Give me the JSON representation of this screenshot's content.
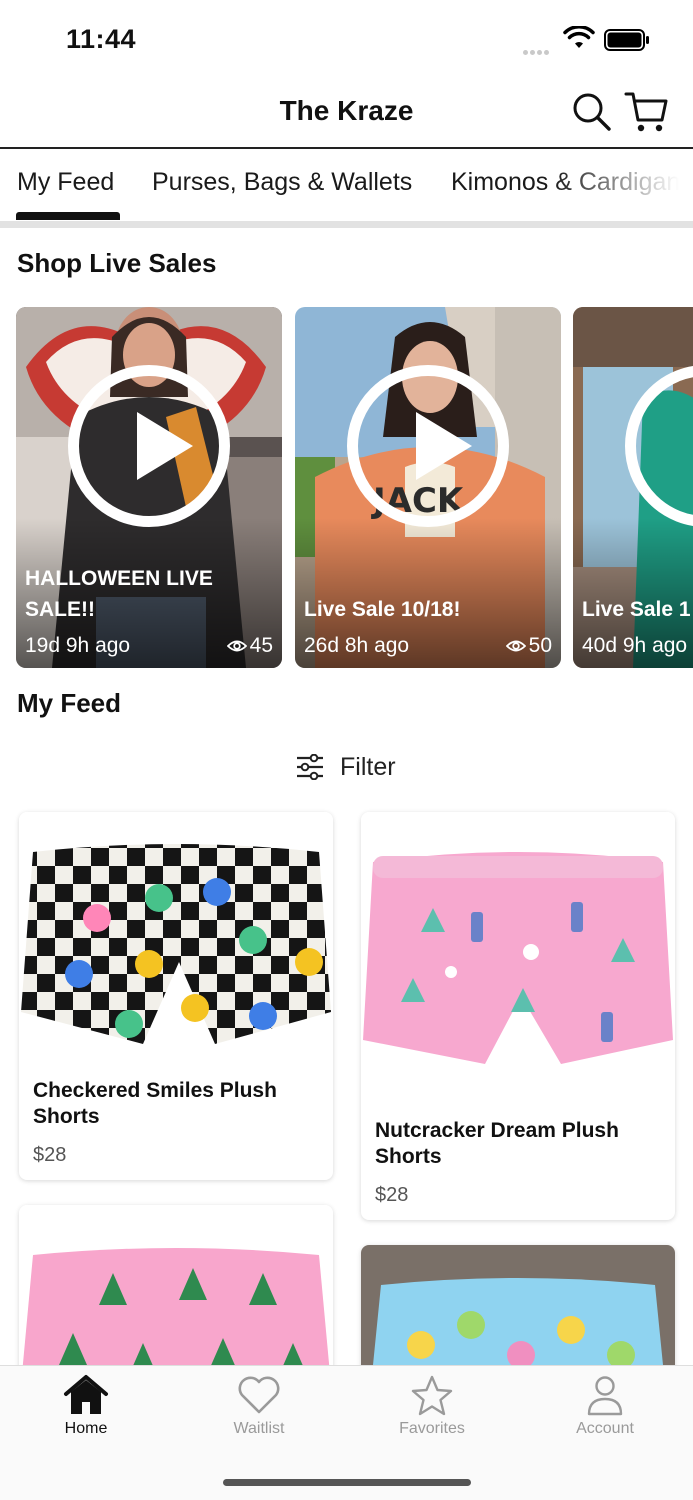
{
  "status_bar": {
    "time": "11:44"
  },
  "header": {
    "title": "The Kraze"
  },
  "tabs": [
    {
      "label": "My Feed",
      "active": true
    },
    {
      "label": "Purses, Bags & Wallets",
      "active": false
    },
    {
      "label": "Kimonos & Cardigans",
      "active": false
    }
  ],
  "live_section": {
    "title": "Shop Live Sales",
    "cards": [
      {
        "title": "HALLOWEEN LIVE SALE!!",
        "ago": "19d 9h ago",
        "views": "45"
      },
      {
        "title": "Live Sale 10/18!",
        "ago": "26d 8h ago",
        "views": "50"
      },
      {
        "title": "Live Sale 1",
        "ago": "40d 9h ago",
        "views": ""
      }
    ]
  },
  "feed_section": {
    "title": "My Feed",
    "filter_label": "Filter"
  },
  "products": [
    {
      "name": "Checkered Smiles Plush Shorts",
      "price": "$28"
    },
    {
      "name": "Nutcracker Dream Plush Shorts",
      "price": "$28"
    },
    {
      "name": "",
      "price": ""
    },
    {
      "name": "",
      "price": ""
    }
  ],
  "bottom_nav": [
    {
      "label": "Home",
      "icon": "home-icon",
      "active": true
    },
    {
      "label": "Waitlist",
      "icon": "heart-icon",
      "active": false
    },
    {
      "label": "Favorites",
      "icon": "star-icon",
      "active": false
    },
    {
      "label": "Account",
      "icon": "person-icon",
      "active": false
    }
  ],
  "colors": {
    "accent": "#111111",
    "inactive": "#9a9a9a",
    "divider": "#e2e2e2"
  }
}
